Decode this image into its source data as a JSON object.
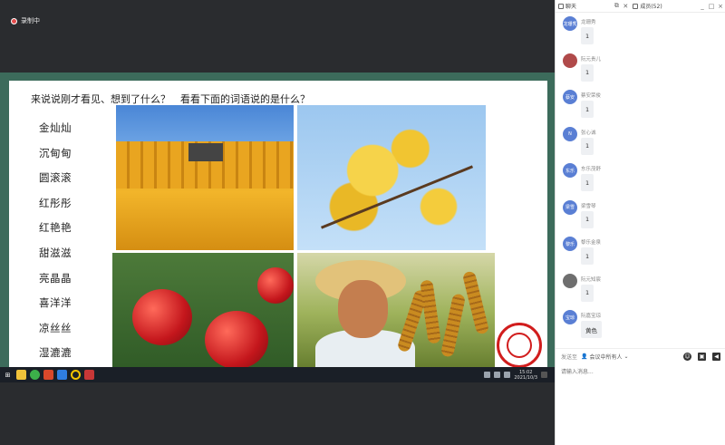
{
  "recording": {
    "label": "录制中",
    "color": "#e34a4a"
  },
  "slide": {
    "title": "来说说刚才看见、想到了什么？　看看下面的词语说的是什么？",
    "words": [
      "金灿灿",
      "沉甸甸",
      "圆滚滚",
      "红彤彤",
      "红艳艳",
      "甜滋滋",
      "亮晶晶",
      "喜洋洋",
      "凉丝丝",
      "湿漉漉"
    ],
    "photos": [
      "corn-harvest-photo",
      "ginkgo-leaves-photo",
      "red-apples-photo",
      "farmer-millet-photo"
    ]
  },
  "taskbar": {
    "apps": [
      "start-icon",
      "file-explorer-icon",
      "browser-icon",
      "office-icon",
      "meeting-app-icon",
      "circle-app-icon",
      "screen-record-icon"
    ],
    "time": "15:02",
    "date": "2021/10/3"
  },
  "panel": {
    "tabs": [
      {
        "label": "聊天",
        "icon": "chat-icon"
      },
      {
        "label": "成员(52)",
        "icon": "members-icon"
      }
    ],
    "window_controls": [
      "_",
      "□",
      "×"
    ]
  },
  "messages": [
    {
      "user": "龙珊秀",
      "avatar_text": "龙珊秀",
      "avatar_color": "#5a7fd4",
      "text": "1"
    },
    {
      "user": "阮元贵儿",
      "avatar_text": "",
      "avatar_color": "#b04a4a",
      "text": "1"
    },
    {
      "user": "蔡安荣俊",
      "avatar_text": "蔡安",
      "avatar_color": "#5a7fd4",
      "text": "1"
    },
    {
      "user": "张心诚",
      "avatar_text": "N",
      "avatar_color": "#5a7fd4",
      "text": "1"
    },
    {
      "user": "东乐茂舒",
      "avatar_text": "东乐",
      "avatar_color": "#5a7fd4",
      "text": "1"
    },
    {
      "user": "梁雪琴",
      "avatar_text": "梁雪",
      "avatar_color": "#5a7fd4",
      "text": "1"
    },
    {
      "user": "黎乐金泉",
      "avatar_text": "黎乐",
      "avatar_color": "#5a7fd4",
      "text": "1"
    },
    {
      "user": "阮元知宸",
      "avatar_text": "",
      "avatar_color": "#6e6e6e",
      "text": "1"
    },
    {
      "user": "阮嘉宝琼",
      "avatar_text": "宝琼",
      "avatar_color": "#5a7fd4",
      "text": "黄色"
    }
  ],
  "composer": {
    "send_to_label": "发送至",
    "send_to_target": "会议中所有人",
    "placeholder": "请输入消息..."
  }
}
